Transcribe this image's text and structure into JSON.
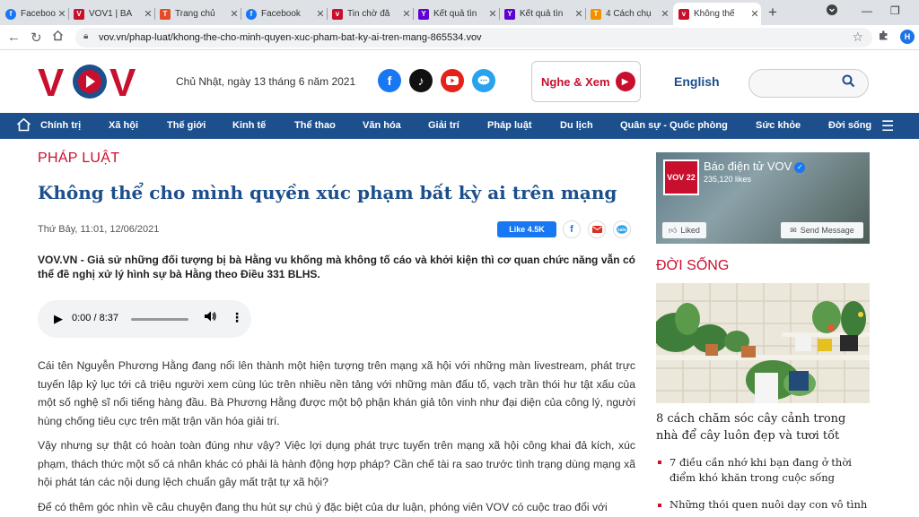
{
  "browser": {
    "tabs": [
      {
        "label": "Facebook",
        "fav": "f",
        "favColor": "#1877f2"
      },
      {
        "label": "VOV1 | BÁ",
        "fav": "V",
        "favColor": "#c8102e"
      },
      {
        "label": "Trang chủ",
        "fav": "T",
        "favColor": "#e34c26"
      },
      {
        "label": "Facebook",
        "fav": "f",
        "favColor": "#1877f2"
      },
      {
        "label": "Tin chờ đă",
        "fav": "v",
        "favColor": "#c8102e"
      },
      {
        "label": "Kết quả tìn",
        "fav": "Y",
        "favColor": "#6001d2"
      },
      {
        "label": "Kết quả tìn",
        "fav": "Y",
        "favColor": "#6001d2"
      },
      {
        "label": "4 Cách chụ",
        "fav": "T",
        "favColor": "#f29100"
      },
      {
        "label": "Không thể",
        "fav": "v",
        "favColor": "#c8102e"
      }
    ],
    "url": "vov.vn/phap-luat/khong-the-cho-minh-quyen-xuc-pham-bat-ky-ai-tren-mang-865534.vov",
    "profile_initial": "H"
  },
  "header": {
    "date": "Chủ Nhật, ngày 13 tháng 6 năm 2021",
    "nghe_xem": "Nghe & Xem",
    "english": "English",
    "logo_text": "VOV"
  },
  "nav": {
    "items": [
      "Chính trị",
      "Xã hội",
      "Thế giới",
      "Kinh tế",
      "Thể thao",
      "Văn hóa",
      "Giải trí",
      "Pháp luật",
      "Du lịch",
      "Quân sự - Quốc phòng",
      "Sức khỏe",
      "Đời sống"
    ]
  },
  "article": {
    "section": "PHÁP LUẬT",
    "title": "Không thể cho mình quyền xúc phạm bất kỳ ai trên mạng",
    "meta": "Thứ Bảy, 11:01, 12/06/2021",
    "like_label": "Like 4.5K",
    "lead": "VOV.VN - Giả sử những đối tượng bị bà Hằng vu khống mà không tố cáo và khởi kiện thì cơ quan chức năng vẫn có thể đề nghị xử lý hình sự bà Hằng theo Điều 331 BLHS.",
    "audio_time": "0:00 / 8:37",
    "paragraphs": [
      "Cái tên Nguyễn Phương Hằng đang nổi lên thành một hiện tượng trên mạng xã hội với những màn livestream, phát trực tuyến lập kỷ lục tới cả triệu người xem cùng lúc trên nhiều nền tảng với những màn đấu tố, vạch trần thói hư tật xấu của một số nghệ sĩ nổi tiếng hàng đầu. Bà Phương Hằng được một bộ phận khán giả tôn vinh như đại diện của công lý, người hùng chống tiêu cực trên mặt trận văn hóa giải trí.",
      "Vậy nhưng sự thật có hoàn toàn đúng như vậy? Việc lợi dụng phát trực tuyến trên mạng xã hội công khai đả kích, xúc phạm, thách thức một số cá nhân khác có phải là hành động hợp pháp? Cần chế tài ra sao trước tình trạng dùng mạng xã hội phát tán các nội dung lệch chuẩn gây mất trật tự xã hội?",
      "Để có thêm góc nhìn về câu chuyện đang thu hút sự chú ý đặc biệt của dư luận, phóng viên VOV có cuộc trao đổi với"
    ]
  },
  "sidebar": {
    "fb_name": "Báo điện tử VOV",
    "fb_likes": "235,120 likes",
    "fb_liked": "Liked",
    "fb_send": "Send Message",
    "fb_logo": "VOV 22",
    "section": "ĐỜI SỐNG",
    "main_title": "8 cách chăm sóc cây cảnh trong nhà để cây luôn đẹp và tươi tốt",
    "items": [
      "7 điều cần nhớ khi bạn đang ở thời điểm khó khăn trong cuộc sống",
      "Những thói quen nuôi dạy con vô tình"
    ]
  }
}
